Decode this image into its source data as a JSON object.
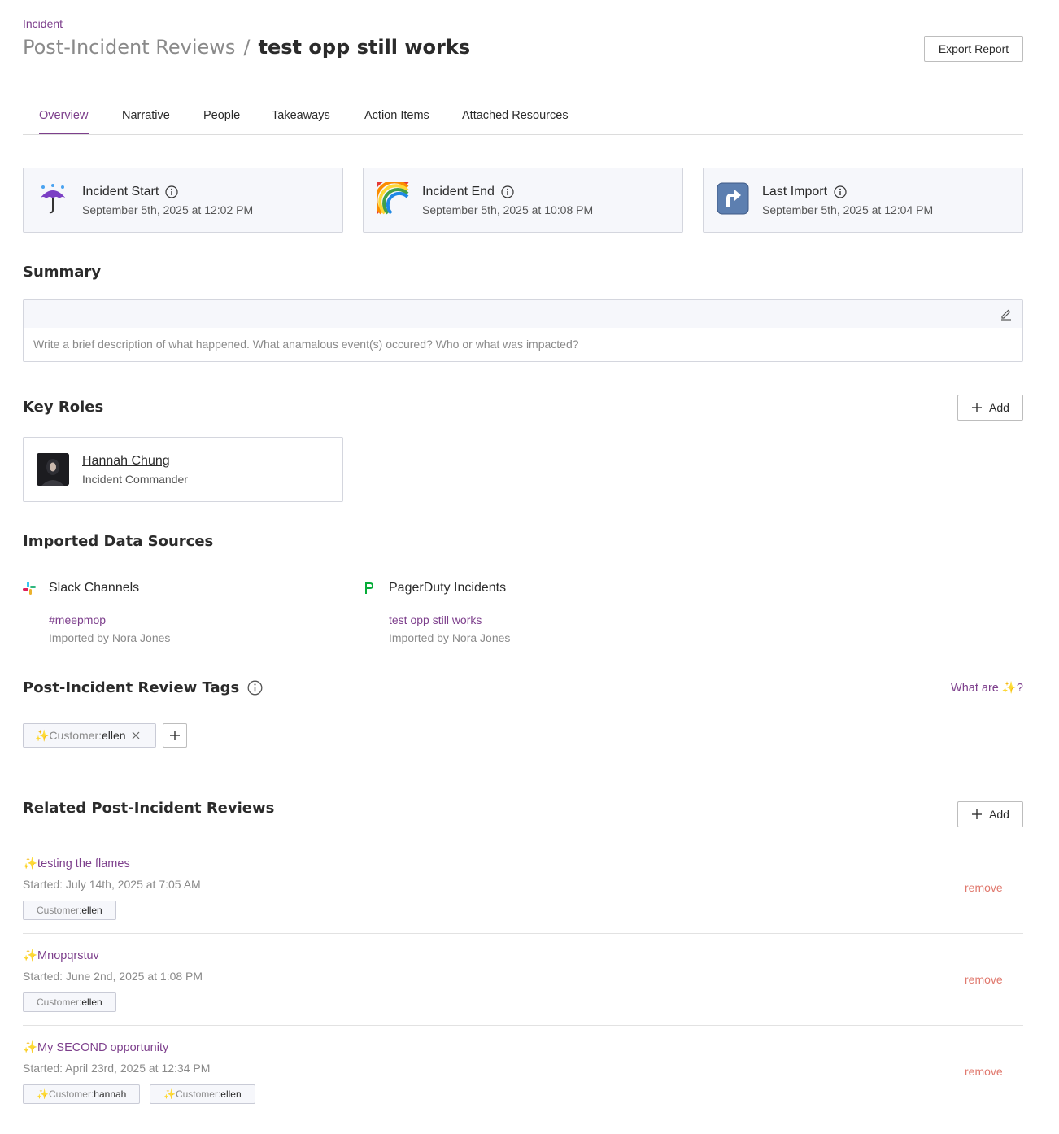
{
  "header": {
    "breadcrumb": "Incident",
    "parent_title": "Post-Incident Reviews",
    "separator": "/",
    "title": "test opp still works",
    "export_label": "Export Report"
  },
  "tabs": [
    {
      "label": "Overview",
      "active": true
    },
    {
      "label": "Narrative"
    },
    {
      "label": "People"
    },
    {
      "label": "Takeaways"
    },
    {
      "label": "Action Items"
    },
    {
      "label": "Attached Resources"
    }
  ],
  "stats": [
    {
      "emoji": "☔",
      "icon": "umbrella-rain-icon",
      "label": "Incident Start",
      "value": "September 5th, 2025 at 12:02 PM"
    },
    {
      "emoji": "🌈",
      "icon": "rainbow-icon",
      "label": "Incident End",
      "value": "September 5th, 2025 at 10:08 PM"
    },
    {
      "emoji": "⤴",
      "icon": "arrow-up-right-icon",
      "label": "Last Import",
      "value": "September 5th, 2025 at 12:04 PM"
    }
  ],
  "summary": {
    "heading": "Summary",
    "placeholder": "Write a brief description of what happened. What anamalous event(s) occured? Who or what was impacted?"
  },
  "key_roles": {
    "heading": "Key Roles",
    "add_label": "Add",
    "roles": [
      {
        "name": "Hannah Chung",
        "role": "Incident Commander"
      }
    ]
  },
  "data_sources": {
    "heading": "Imported Data Sources",
    "sources": [
      {
        "icon": "slack-icon",
        "title": "Slack Channels",
        "link": "#meepmop",
        "imported_by": "Imported by Nora Jones"
      },
      {
        "icon": "pagerduty-icon",
        "title": "PagerDuty Incidents",
        "link": "test opp still works",
        "imported_by": "Imported by Nora Jones"
      }
    ]
  },
  "review_tags": {
    "heading": "Post-Incident Review Tags",
    "help_link": "What are ✨?",
    "tags": [
      {
        "key": "✨Customer:",
        "value": "ellen"
      }
    ]
  },
  "related": {
    "heading": "Related Post-Incident Reviews",
    "add_label": "Add",
    "remove_label": "remove",
    "items": [
      {
        "title": "✨testing the flames",
        "started": "Started: July 14th, 2025 at 7:05 AM",
        "tags": [
          {
            "key": "Customer:",
            "value": "ellen"
          }
        ]
      },
      {
        "title": "✨Mnopqrstuv",
        "started": "Started: June 2nd, 2025 at 1:08 PM",
        "tags": [
          {
            "key": "Customer:",
            "value": "ellen"
          }
        ]
      },
      {
        "title": "✨My SECOND opportunity",
        "started": "Started: April 23rd, 2025 at 12:34 PM",
        "tags": [
          {
            "key": "✨Customer:",
            "value": "hannah"
          },
          {
            "key": "✨Customer:",
            "value": "ellen"
          }
        ]
      }
    ]
  },
  "colors": {
    "accent": "#7d3f8c",
    "remove": "#e0786d",
    "card_bg": "#f6f7fb"
  }
}
